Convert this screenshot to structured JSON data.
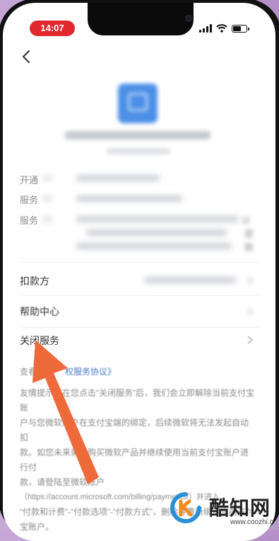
{
  "status_bar": {
    "time": "14:07"
  },
  "header": {
    "back_icon": "chevron-left-icon"
  },
  "rows": {
    "open_label": "开通",
    "service_label": "服务",
    "service_detail_label": "服务",
    "detail_fragments": [
      "计",
      "密",
      "款"
    ],
    "deduct_label": "扣款方",
    "help_label": "帮助中心",
    "close_label": "关闭服务"
  },
  "links": {
    "view_prefix": "查看",
    "agreement_suffix": "权服务协议》"
  },
  "notice": {
    "line1": "友情提示：在您点击“关闭服务”后，我们会立即解除当前支付宝账",
    "line2": "户与您微软账户在支付宝端的绑定，后续微软将无法发起自动扣",
    "line3": "款。如您未来需要购买微软产品并继续使用当前支付宝账户进行付",
    "line4": "款，请登陆至微软账户",
    "line5": "（https://account.microsoft.com/billing/payments/）并进入",
    "line6": "“付款和计费”-“付款选项”-“付款方式”，删除并重新绑定当前支付",
    "line7": "宝账户。"
  },
  "watermark": {
    "brand": "酷知网",
    "url": "www.coozhi.com"
  },
  "colors": {
    "accent_red": "#e0282e",
    "arrow": "#ef6a3a",
    "link": "#4a77c7",
    "logo_blue": "#4c8fe6"
  }
}
